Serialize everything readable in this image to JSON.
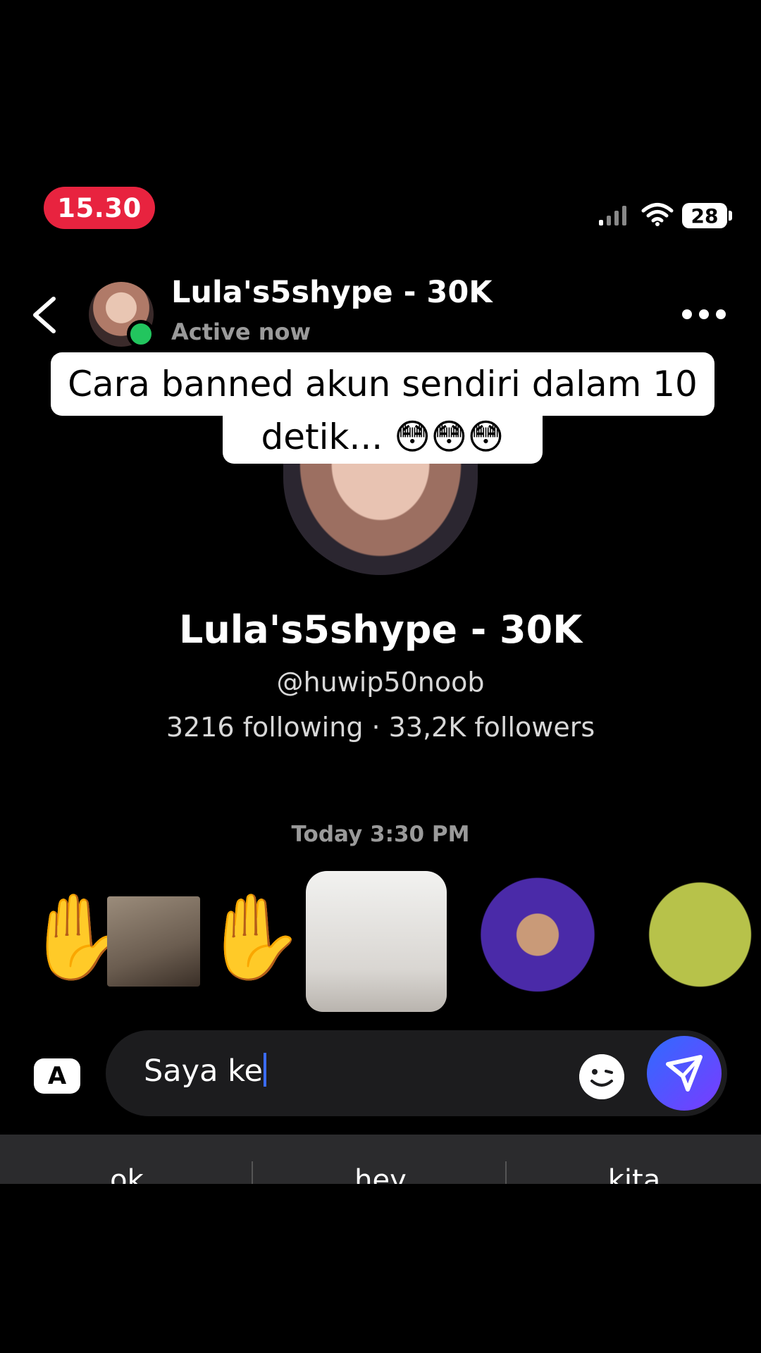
{
  "status_bar": {
    "time": "15.30",
    "battery": "28"
  },
  "header": {
    "name": "Lula's5shype - 30K",
    "status": "Active now"
  },
  "caption": {
    "line1": "Cara banned akun sendiri dalam 10",
    "line2": "detik... 😳😳😳"
  },
  "profile": {
    "name": "Lula's5shype - 30K",
    "handle": "@huwip50noob",
    "stats": "3216 following · 33,2K followers"
  },
  "chat": {
    "timestamp": "Today 3:30 PM",
    "stickers": [
      "✋",
      "✋"
    ]
  },
  "composer": {
    "keyboard_toggle": "A",
    "text": "Saya ke"
  },
  "keyboard": {
    "suggestions": [
      "ok",
      "hey",
      "kita"
    ]
  },
  "colors": {
    "time_pill": "#e8233f",
    "online": "#22c55e",
    "send_start": "#2f6bff",
    "send_end": "#7a3bff",
    "cursor": "#3b6cff"
  }
}
